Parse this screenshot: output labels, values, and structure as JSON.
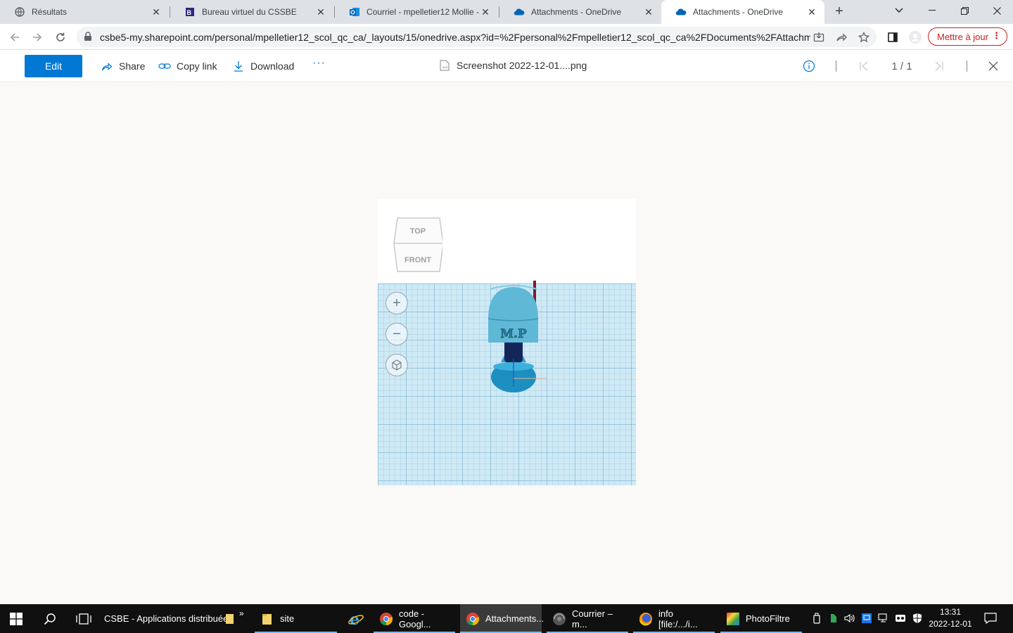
{
  "browser": {
    "tabs": [
      {
        "title": "Résultats",
        "icon": "globe-icon",
        "active": false
      },
      {
        "title": "Bureau virtuel du CSSBE",
        "icon": "cssbe-icon",
        "active": false
      },
      {
        "title": "Courriel - mpelletier12 Mollie -",
        "icon": "outlook-icon",
        "active": false
      },
      {
        "title": "Attachments - OneDrive",
        "icon": "onedrive-icon",
        "active": false
      },
      {
        "title": "Attachments - OneDrive",
        "icon": "onedrive-icon",
        "active": true
      }
    ],
    "url": "csbe5-my.sharepoint.com/personal/mpelletier12_scol_qc_ca/_layouts/15/onedrive.aspx?id=%2Fpersonal%2Fmpelletier12_scol_qc_ca%2FDocuments%2FAttachm...",
    "update_label": "Mettre à jour"
  },
  "viewer": {
    "edit_label": "Edit",
    "share_label": "Share",
    "copy_link_label": "Copy link",
    "download_label": "Download",
    "more_label": "···",
    "file_name": "Screenshot 2022-12-01....png",
    "page_counter": "1 / 1"
  },
  "preview": {
    "viewcube_top": "TOP",
    "viewcube_front": "FRONT",
    "model_text": "M.P"
  },
  "taskbar": {
    "items": [
      {
        "label": "CSBE - Applications distribuées"
      },
      {
        "label": "site"
      },
      {
        "label": "code - Googl..."
      },
      {
        "label": "Attachments..."
      },
      {
        "label": "Courrier – m..."
      },
      {
        "label": "info [file:/.../i..."
      },
      {
        "label": "PhotoFiltre"
      }
    ],
    "overflow": "»",
    "time": "13:31",
    "date": "2022-12-01"
  },
  "colors": {
    "accent": "#0078d4",
    "update_red": "#c5221f",
    "taskbar": "#101010",
    "grid": "#cfe9f5",
    "model": "#5fb8d6"
  }
}
